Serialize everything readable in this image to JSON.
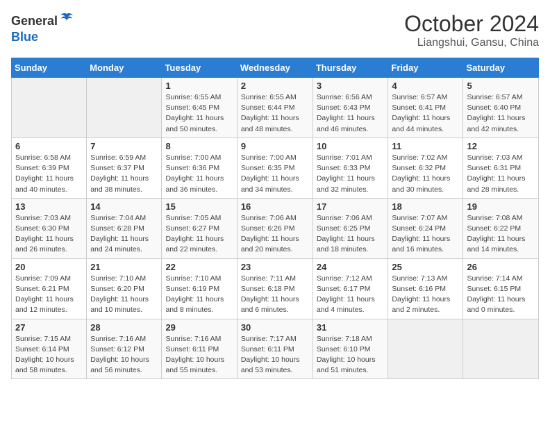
{
  "header": {
    "logo_general": "General",
    "logo_blue": "Blue",
    "title": "October 2024",
    "subtitle": "Liangshui, Gansu, China"
  },
  "days_of_week": [
    "Sunday",
    "Monday",
    "Tuesday",
    "Wednesday",
    "Thursday",
    "Friday",
    "Saturday"
  ],
  "weeks": [
    [
      {
        "day": "",
        "info": ""
      },
      {
        "day": "",
        "info": ""
      },
      {
        "day": "1",
        "info": "Sunrise: 6:55 AM\nSunset: 6:45 PM\nDaylight: 11 hours and 50 minutes."
      },
      {
        "day": "2",
        "info": "Sunrise: 6:55 AM\nSunset: 6:44 PM\nDaylight: 11 hours and 48 minutes."
      },
      {
        "day": "3",
        "info": "Sunrise: 6:56 AM\nSunset: 6:43 PM\nDaylight: 11 hours and 46 minutes."
      },
      {
        "day": "4",
        "info": "Sunrise: 6:57 AM\nSunset: 6:41 PM\nDaylight: 11 hours and 44 minutes."
      },
      {
        "day": "5",
        "info": "Sunrise: 6:57 AM\nSunset: 6:40 PM\nDaylight: 11 hours and 42 minutes."
      }
    ],
    [
      {
        "day": "6",
        "info": "Sunrise: 6:58 AM\nSunset: 6:39 PM\nDaylight: 11 hours and 40 minutes."
      },
      {
        "day": "7",
        "info": "Sunrise: 6:59 AM\nSunset: 6:37 PM\nDaylight: 11 hours and 38 minutes."
      },
      {
        "day": "8",
        "info": "Sunrise: 7:00 AM\nSunset: 6:36 PM\nDaylight: 11 hours and 36 minutes."
      },
      {
        "day": "9",
        "info": "Sunrise: 7:00 AM\nSunset: 6:35 PM\nDaylight: 11 hours and 34 minutes."
      },
      {
        "day": "10",
        "info": "Sunrise: 7:01 AM\nSunset: 6:33 PM\nDaylight: 11 hours and 32 minutes."
      },
      {
        "day": "11",
        "info": "Sunrise: 7:02 AM\nSunset: 6:32 PM\nDaylight: 11 hours and 30 minutes."
      },
      {
        "day": "12",
        "info": "Sunrise: 7:03 AM\nSunset: 6:31 PM\nDaylight: 11 hours and 28 minutes."
      }
    ],
    [
      {
        "day": "13",
        "info": "Sunrise: 7:03 AM\nSunset: 6:30 PM\nDaylight: 11 hours and 26 minutes."
      },
      {
        "day": "14",
        "info": "Sunrise: 7:04 AM\nSunset: 6:28 PM\nDaylight: 11 hours and 24 minutes."
      },
      {
        "day": "15",
        "info": "Sunrise: 7:05 AM\nSunset: 6:27 PM\nDaylight: 11 hours and 22 minutes."
      },
      {
        "day": "16",
        "info": "Sunrise: 7:06 AM\nSunset: 6:26 PM\nDaylight: 11 hours and 20 minutes."
      },
      {
        "day": "17",
        "info": "Sunrise: 7:06 AM\nSunset: 6:25 PM\nDaylight: 11 hours and 18 minutes."
      },
      {
        "day": "18",
        "info": "Sunrise: 7:07 AM\nSunset: 6:24 PM\nDaylight: 11 hours and 16 minutes."
      },
      {
        "day": "19",
        "info": "Sunrise: 7:08 AM\nSunset: 6:22 PM\nDaylight: 11 hours and 14 minutes."
      }
    ],
    [
      {
        "day": "20",
        "info": "Sunrise: 7:09 AM\nSunset: 6:21 PM\nDaylight: 11 hours and 12 minutes."
      },
      {
        "day": "21",
        "info": "Sunrise: 7:10 AM\nSunset: 6:20 PM\nDaylight: 11 hours and 10 minutes."
      },
      {
        "day": "22",
        "info": "Sunrise: 7:10 AM\nSunset: 6:19 PM\nDaylight: 11 hours and 8 minutes."
      },
      {
        "day": "23",
        "info": "Sunrise: 7:11 AM\nSunset: 6:18 PM\nDaylight: 11 hours and 6 minutes."
      },
      {
        "day": "24",
        "info": "Sunrise: 7:12 AM\nSunset: 6:17 PM\nDaylight: 11 hours and 4 minutes."
      },
      {
        "day": "25",
        "info": "Sunrise: 7:13 AM\nSunset: 6:16 PM\nDaylight: 11 hours and 2 minutes."
      },
      {
        "day": "26",
        "info": "Sunrise: 7:14 AM\nSunset: 6:15 PM\nDaylight: 11 hours and 0 minutes."
      }
    ],
    [
      {
        "day": "27",
        "info": "Sunrise: 7:15 AM\nSunset: 6:14 PM\nDaylight: 10 hours and 58 minutes."
      },
      {
        "day": "28",
        "info": "Sunrise: 7:16 AM\nSunset: 6:12 PM\nDaylight: 10 hours and 56 minutes."
      },
      {
        "day": "29",
        "info": "Sunrise: 7:16 AM\nSunset: 6:11 PM\nDaylight: 10 hours and 55 minutes."
      },
      {
        "day": "30",
        "info": "Sunrise: 7:17 AM\nSunset: 6:11 PM\nDaylight: 10 hours and 53 minutes."
      },
      {
        "day": "31",
        "info": "Sunrise: 7:18 AM\nSunset: 6:10 PM\nDaylight: 10 hours and 51 minutes."
      },
      {
        "day": "",
        "info": ""
      },
      {
        "day": "",
        "info": ""
      }
    ]
  ]
}
